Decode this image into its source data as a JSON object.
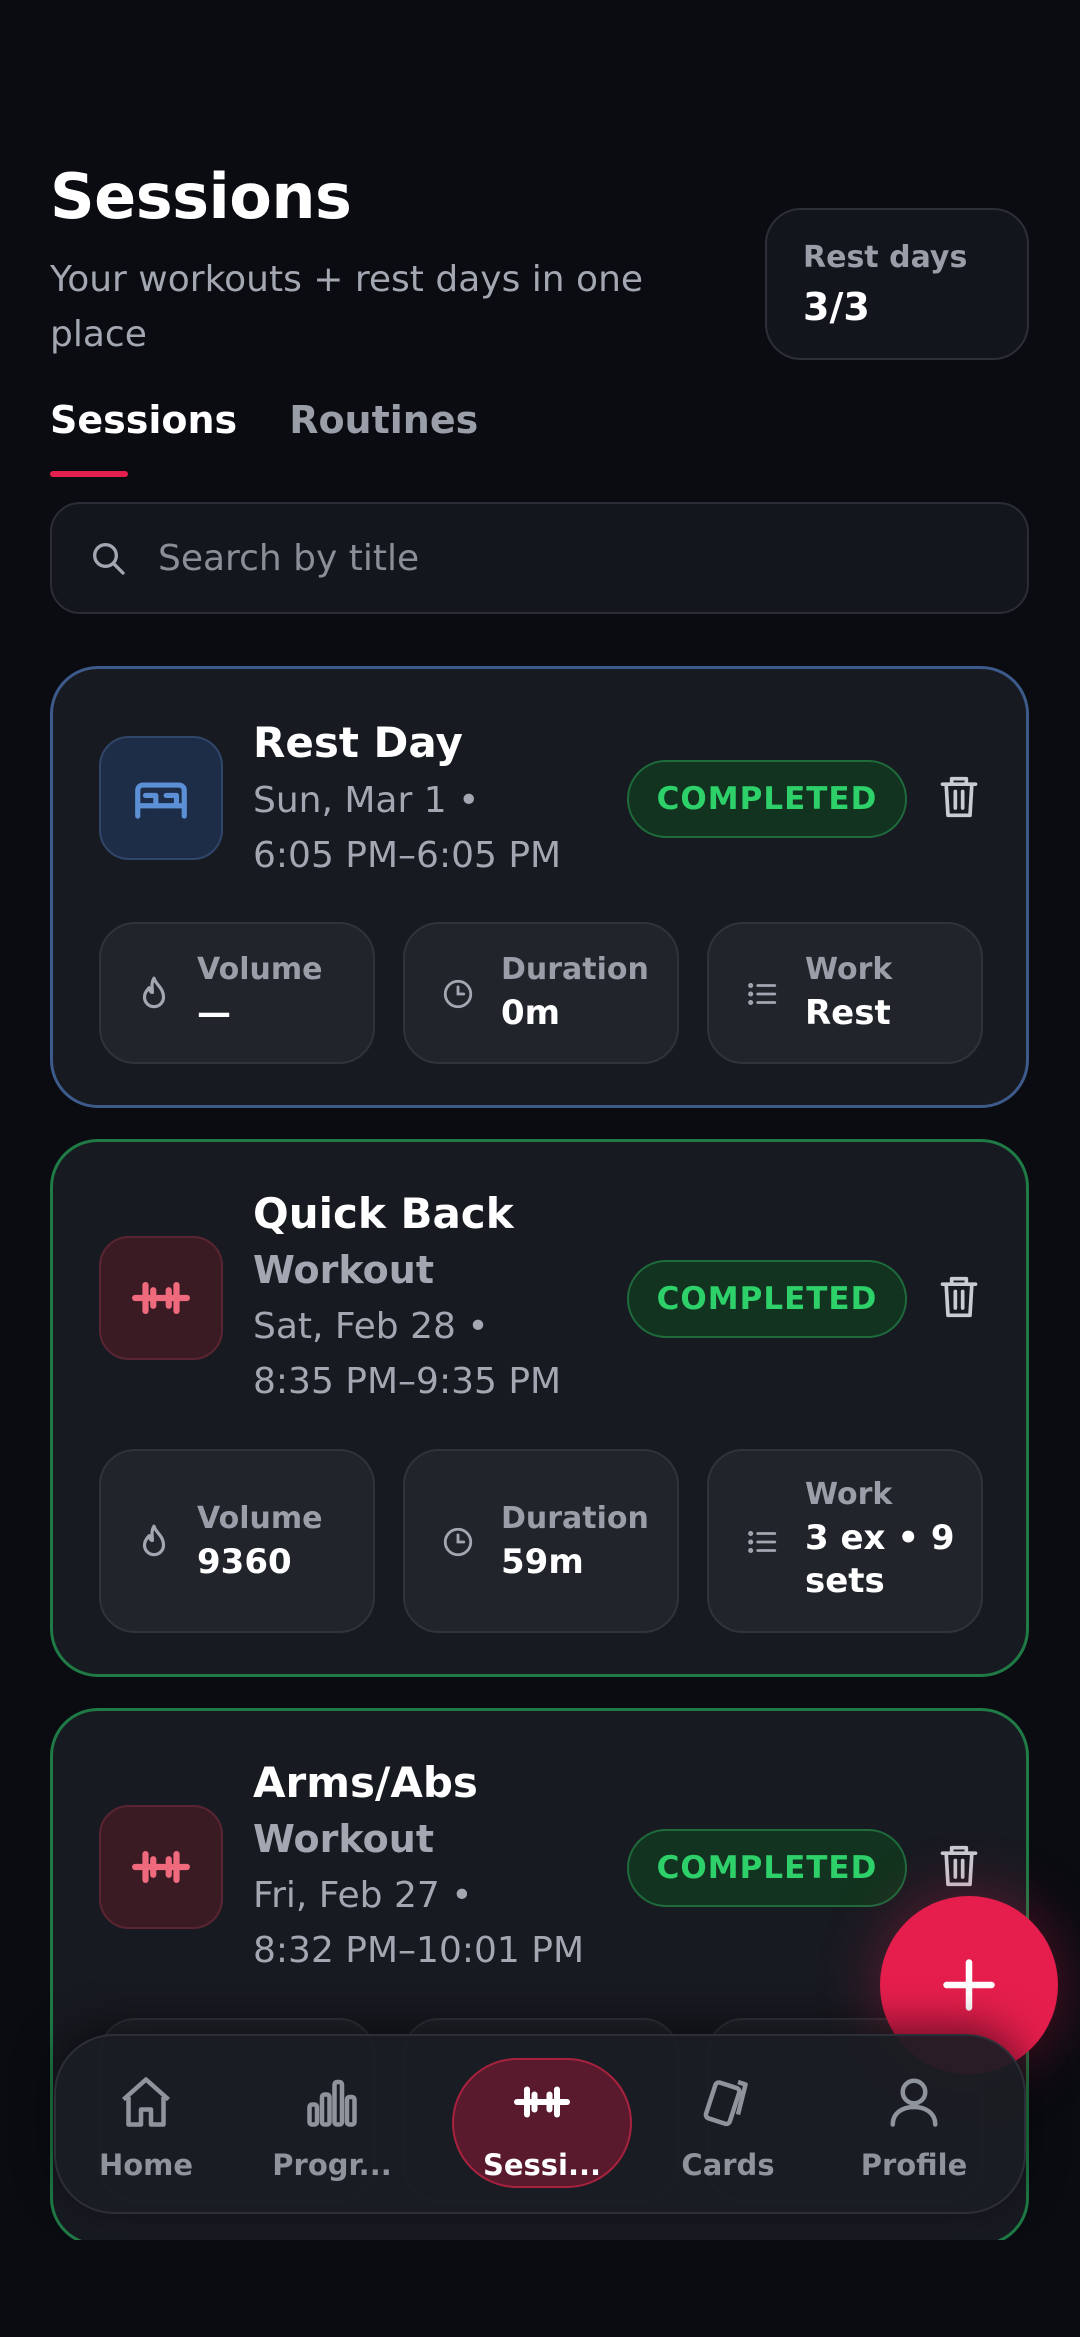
{
  "header": {
    "title": "Sessions",
    "subtitle": "Your workouts + rest days in one place",
    "rest_days_label": "Rest days",
    "rest_days_value": "3/3"
  },
  "tabs": [
    {
      "label": "Sessions",
      "active": true
    },
    {
      "label": "Routines",
      "active": false
    }
  ],
  "search": {
    "placeholder": "Search by title",
    "value": ""
  },
  "sessions": [
    {
      "title": "Rest Day",
      "subtitle": "",
      "date": "Sun, Mar 1 •",
      "time": "6:05 PM–6:05 PM",
      "icon": "bed-icon",
      "status": "COMPLETED",
      "stats": [
        {
          "label": "Volume",
          "value": "—",
          "icon": "flame-icon"
        },
        {
          "label": "Duration",
          "value": "0m",
          "icon": "clock-icon"
        },
        {
          "label": "Work",
          "value": "Rest",
          "icon": "list-icon"
        }
      ]
    },
    {
      "title": "Quick Back",
      "subtitle": "Workout",
      "date": "Sat, Feb 28 •",
      "time": "8:35 PM–9:35 PM",
      "icon": "dumbbell-icon",
      "status": "COMPLETED",
      "stats": [
        {
          "label": "Volume",
          "value": "9360",
          "icon": "flame-icon"
        },
        {
          "label": "Duration",
          "value": "59m",
          "icon": "clock-icon"
        },
        {
          "label": "Work",
          "value": "3 ex • 9 sets",
          "icon": "list-icon"
        }
      ]
    },
    {
      "title": "Arms/Abs",
      "subtitle": "Workout",
      "date": "Fri, Feb 27 •",
      "time": "8:32 PM–10:01 PM",
      "icon": "dumbbell-icon",
      "status": "COMPLETED"
    }
  ],
  "nav": [
    {
      "label": "Home",
      "icon": "home-icon",
      "active": false
    },
    {
      "label": "Progr...",
      "icon": "bar-chart-icon",
      "active": false
    },
    {
      "label": "Sessi...",
      "icon": "dumbbell-icon",
      "active": true
    },
    {
      "label": "Cards",
      "icon": "cards-icon",
      "active": false
    },
    {
      "label": "Profile",
      "icon": "person-icon",
      "active": false
    }
  ],
  "colors": {
    "background": "#0a0c12",
    "accent": "#e51e4d",
    "success": "#2ed06a",
    "rest_border": "#3c5a8a",
    "workout_border": "#1f7a45"
  }
}
